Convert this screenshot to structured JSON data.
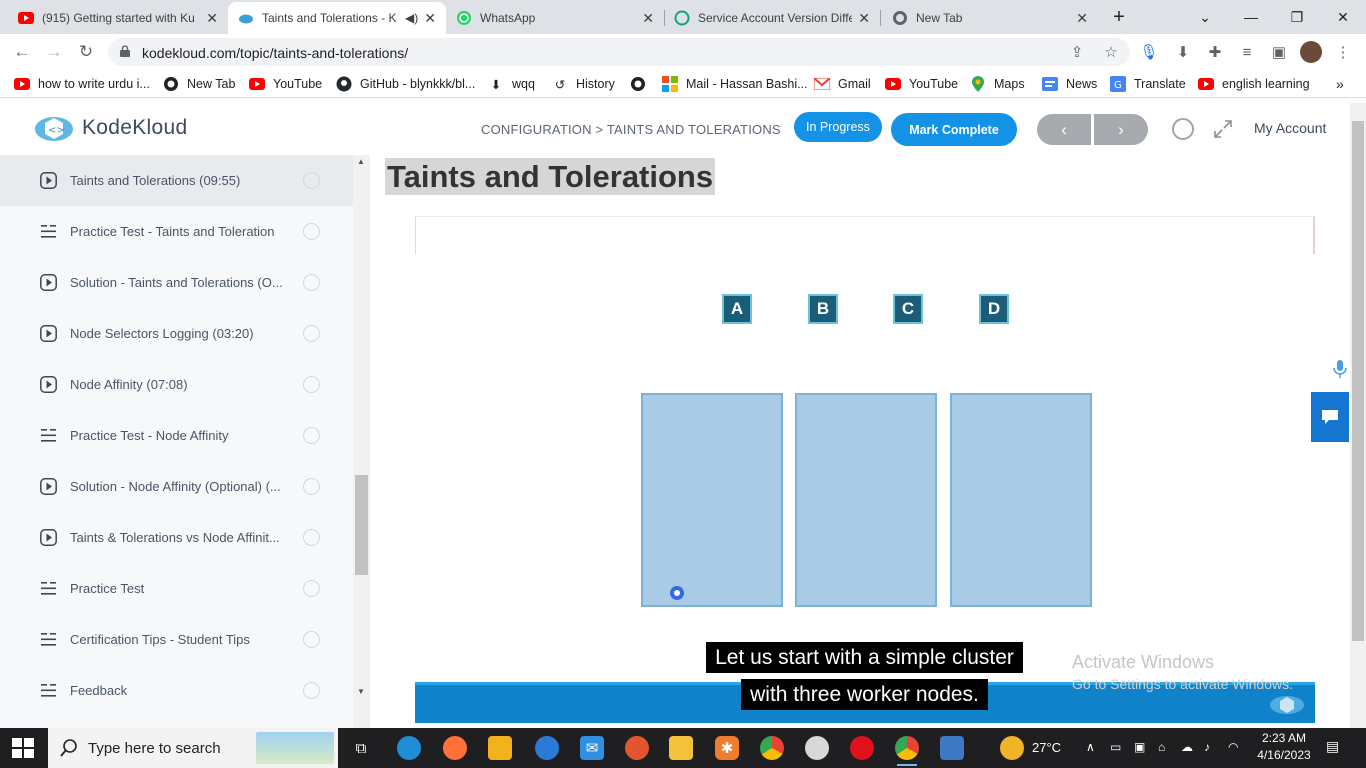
{
  "browser": {
    "tabs": [
      {
        "title": "(915) Getting started with Ku",
        "favicon_color": "#ff0000",
        "active": false
      },
      {
        "title": "Taints and Tolerations - K",
        "favicon_color": "#3aa0d8",
        "active": true
      },
      {
        "title": "WhatsApp",
        "favicon_color": "#25d366",
        "active": false
      },
      {
        "title": "Service Account Version Diffe",
        "favicon_color": "#10a37f",
        "active": false
      },
      {
        "title": "New Tab",
        "favicon_color": "#5f6368",
        "active": false
      }
    ],
    "url": "kodekloud.com/topic/taints-and-tolerations/",
    "bookmarks": [
      {
        "label": "how to write urdu i...",
        "icon": "youtube-icon"
      },
      {
        "label": "New Tab",
        "icon": "globe-icon"
      },
      {
        "label": "YouTube",
        "icon": "youtube-icon"
      },
      {
        "label": "GitHub - blynkkk/bl...",
        "icon": "github-icon"
      },
      {
        "label": "wqq",
        "icon": "download-icon"
      },
      {
        "label": "History",
        "icon": "history-icon"
      },
      {
        "label": "",
        "icon": "globe-icon"
      },
      {
        "label": "Mail - Hassan Bashi...",
        "icon": "microsoft-icon"
      },
      {
        "label": "Gmail",
        "icon": "gmail-icon"
      },
      {
        "label": "YouTube",
        "icon": "youtube-icon"
      },
      {
        "label": "Maps",
        "icon": "maps-icon"
      },
      {
        "label": "News",
        "icon": "news-icon"
      },
      {
        "label": "Translate",
        "icon": "translate-icon"
      },
      {
        "label": "english learning",
        "icon": "youtube-icon"
      }
    ]
  },
  "header": {
    "logo_text": "KodeKloud",
    "breadcrumb": "CONFIGURATION > TAINTS AND TOLERATIONS",
    "in_progress_label": "In Progress",
    "mark_complete_label": "Mark Complete",
    "prev_label": "‹",
    "next_label": "›",
    "account_label": "My Account"
  },
  "sidebar": {
    "lessons": [
      {
        "title": "Taints and Tolerations (09:55)",
        "type": "video",
        "current": true
      },
      {
        "title": "Practice Test - Taints and Toleration",
        "type": "test",
        "current": false
      },
      {
        "title": "Solution - Taints and Tolerations (O...",
        "type": "video",
        "current": false
      },
      {
        "title": "Node Selectors Logging (03:20)",
        "type": "video",
        "current": false
      },
      {
        "title": "Node Affinity (07:08)",
        "type": "video",
        "current": false
      },
      {
        "title": "Practice Test - Node Affinity",
        "type": "test",
        "current": false
      },
      {
        "title": "Solution - Node Affinity (Optional) (...",
        "type": "video",
        "current": false
      },
      {
        "title": "Taints & Tolerations vs Node Affinit...",
        "type": "video",
        "current": false
      },
      {
        "title": "Practice Test",
        "type": "test",
        "current": false
      },
      {
        "title": "Certification Tips - Student Tips",
        "type": "test",
        "current": false
      },
      {
        "title": "Feedback",
        "type": "test",
        "current": false
      }
    ]
  },
  "content": {
    "title": "Taints and Tolerations",
    "pod_labels": [
      "A",
      "B",
      "C",
      "D"
    ],
    "caption_line1": "Let us start with a simple cluster",
    "caption_line2": "with three worker nodes.",
    "watermark_line1": "Activate Windows",
    "watermark_line2": "Go to Settings to activate Windows."
  },
  "taskbar": {
    "search_placeholder": "Type here to search",
    "temperature": "27°C",
    "time": "2:23 AM",
    "date": "4/16/2023"
  }
}
